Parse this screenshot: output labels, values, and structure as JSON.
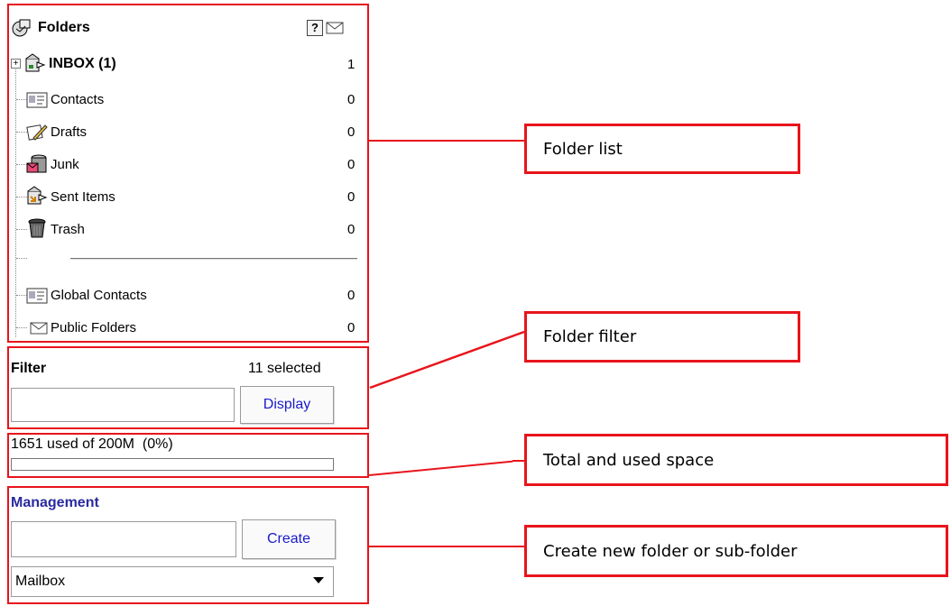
{
  "folders_panel": {
    "title": "Folders",
    "help_icon": "?",
    "items": [
      {
        "label": "INBOX (1)",
        "count": "1",
        "icon": "inbox-icon"
      },
      {
        "label": "Contacts",
        "count": "0",
        "icon": "contacts-card-icon"
      },
      {
        "label": "Drafts",
        "count": "0",
        "icon": "drafts-pencil-icon"
      },
      {
        "label": "Junk",
        "count": "0",
        "icon": "junk-icon"
      },
      {
        "label": "Sent Items",
        "count": "0",
        "icon": "sent-items-icon"
      },
      {
        "label": "Trash",
        "count": "0",
        "icon": "trash-can-icon"
      }
    ],
    "shared_items": [
      {
        "label": "Global Contacts",
        "count": "0",
        "icon": "contacts-card-icon"
      },
      {
        "label": "Public Folders",
        "count": "0",
        "icon": "envelope-icon"
      }
    ]
  },
  "filter": {
    "title": "Filter",
    "selected": "11 selected",
    "input_value": "",
    "display_button": "Display"
  },
  "quota": {
    "text": "1651 used of 200M  (0%)",
    "used_fraction": 0.0
  },
  "management": {
    "title": "Management",
    "input_value": "",
    "create_button": "Create",
    "select_value": "Mailbox"
  },
  "callouts": {
    "folder_list": "Folder list",
    "folder_filter": "Folder filter",
    "total_used": "Total and used space",
    "create_folder": "Create new folder or sub-folder"
  },
  "colors": {
    "annotation_red": "#e8141c",
    "link_blue": "#1a1acc",
    "management_blue": "#2a2aa0"
  }
}
